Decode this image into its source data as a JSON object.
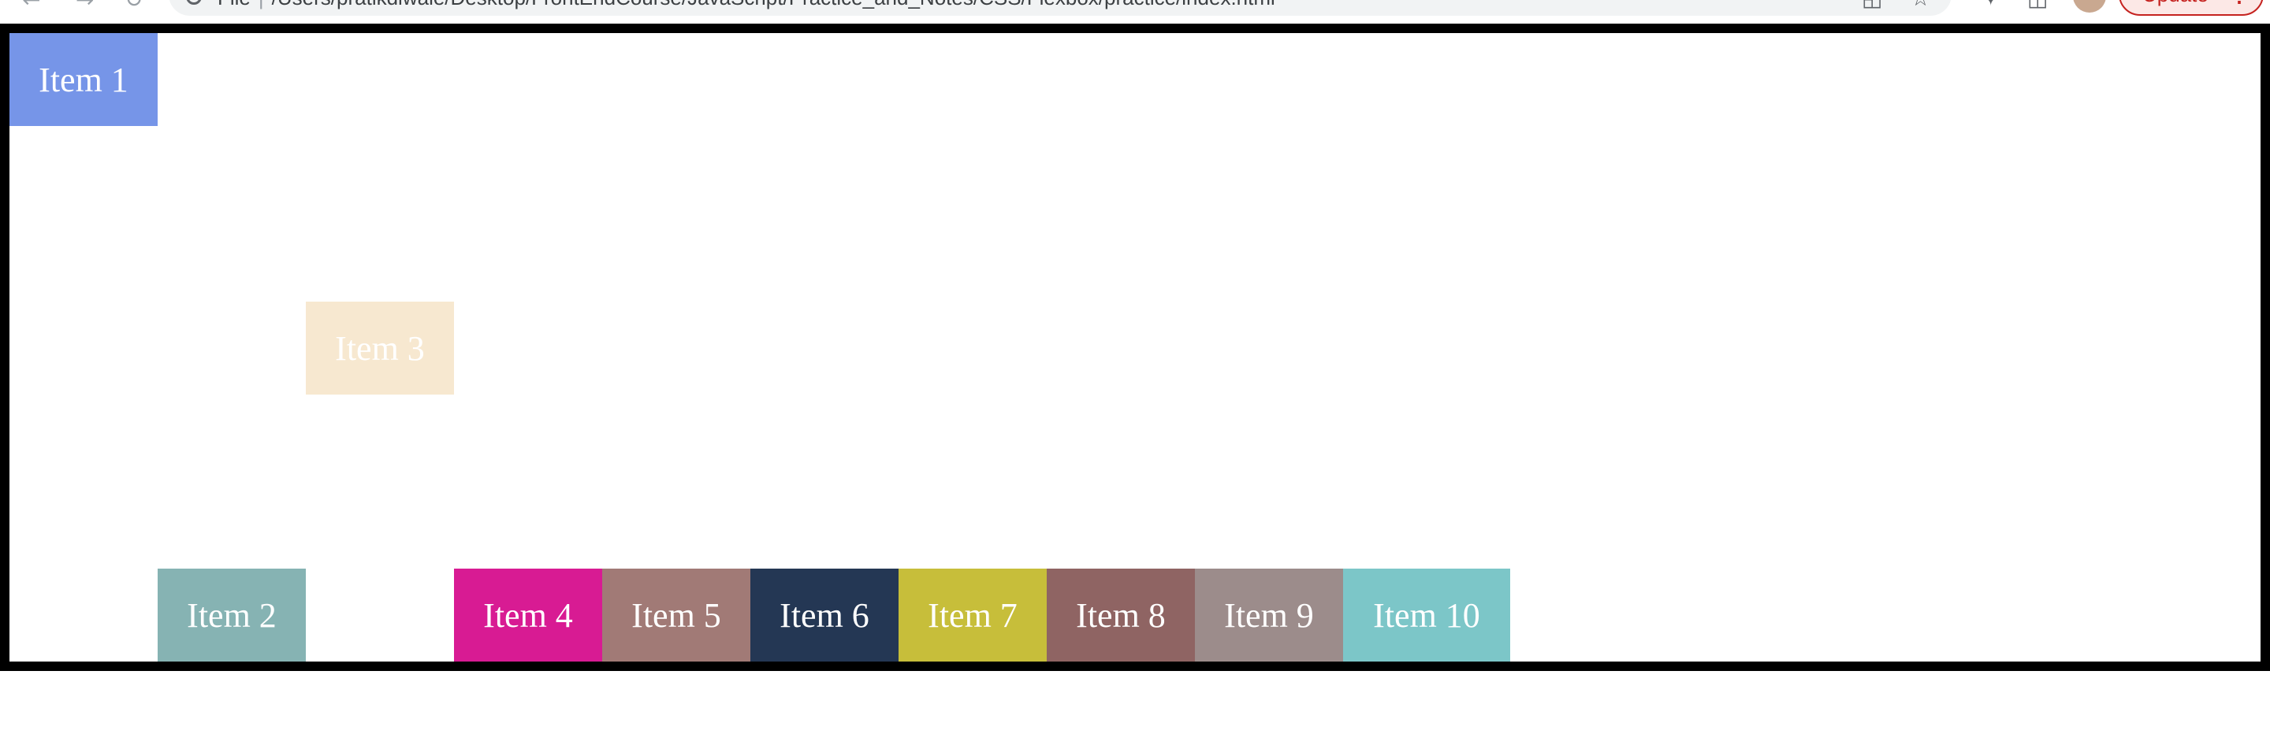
{
  "browser": {
    "url_scheme": "File",
    "url": "/Users/pratikdiwale/Desktop/FrontEndCourse/JavaScript/Practice_and_Notes/CSS/Flexbox/practice/index.html",
    "update_label": "Update",
    "icons": {
      "back": "back-arrow-icon",
      "forward": "forward-arrow-icon",
      "reload": "reload-icon",
      "info": "info-icon",
      "share": "share-icon",
      "bookmark": "star-icon",
      "extensions": "puzzle-icon",
      "sidebar": "side-panel-icon",
      "profile": "avatar",
      "menu": "more-vert-icon"
    }
  },
  "items": [
    {
      "label": "Item 1",
      "color": "#7695e8"
    },
    {
      "label": "Item 2",
      "color": "#86b3b3"
    },
    {
      "label": "Item 3",
      "color": "#f7e8d0"
    },
    {
      "label": "Item 4",
      "color": "#d81b93"
    },
    {
      "label": "Item 5",
      "color": "#a17a76"
    },
    {
      "label": "Item 6",
      "color": "#243754"
    },
    {
      "label": "Item 7",
      "color": "#c7be3a"
    },
    {
      "label": "Item 8",
      "color": "#8f6463"
    },
    {
      "label": "Item 9",
      "color": "#9c8c8b"
    },
    {
      "label": "Item 10",
      "color": "#7cc6c8"
    }
  ]
}
